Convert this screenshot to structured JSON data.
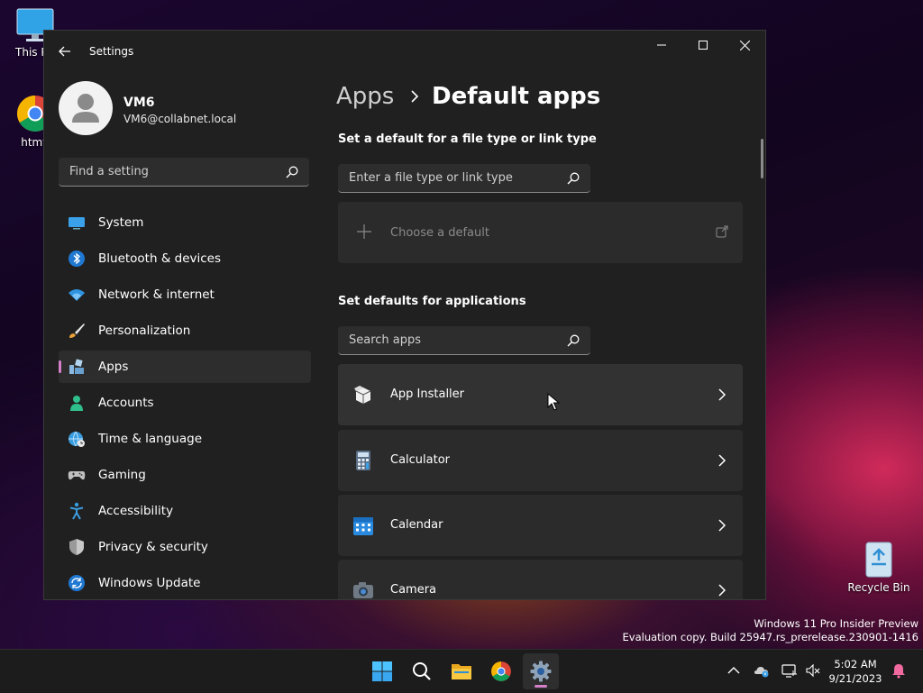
{
  "desktop": {
    "icons": [
      {
        "label": "This PC",
        "name": "desktop-icon-this-pc"
      },
      {
        "label": "htmfi",
        "name": "desktop-icon-chrome-shortcut"
      },
      {
        "label": "Recycle Bin",
        "name": "desktop-icon-recycle-bin"
      }
    ],
    "watermark": {
      "line1": "Windows 11 Pro Insider Preview",
      "line2": "Evaluation copy. Build 25947.rs_prerelease.230901-1416"
    }
  },
  "window": {
    "title": "Settings",
    "profile": {
      "name": "VM6",
      "email": "VM6@collabnet.local"
    },
    "search": {
      "placeholder": "Find a setting"
    },
    "nav": [
      {
        "label": "System",
        "icon": "monitor-icon",
        "active": false
      },
      {
        "label": "Bluetooth & devices",
        "icon": "bluetooth-icon",
        "active": false
      },
      {
        "label": "Network & internet",
        "icon": "wifi-icon",
        "active": false
      },
      {
        "label": "Personalization",
        "icon": "brush-icon",
        "active": false
      },
      {
        "label": "Apps",
        "icon": "apps-icon",
        "active": true
      },
      {
        "label": "Accounts",
        "icon": "person-icon",
        "active": false
      },
      {
        "label": "Time & language",
        "icon": "globe-clock-icon",
        "active": false
      },
      {
        "label": "Gaming",
        "icon": "gamepad-icon",
        "active": false
      },
      {
        "label": "Accessibility",
        "icon": "accessibility-icon",
        "active": false
      },
      {
        "label": "Privacy & security",
        "icon": "shield-icon",
        "active": false
      },
      {
        "label": "Windows Update",
        "icon": "update-icon",
        "active": false
      }
    ],
    "breadcrumb": {
      "parent": "Apps",
      "current": "Default apps"
    },
    "filetype": {
      "heading": "Set a default for a file type or link type",
      "placeholder": "Enter a file type or link type",
      "choose_label": "Choose a default"
    },
    "apps_section": {
      "heading": "Set defaults for applications",
      "placeholder": "Search apps",
      "apps": [
        {
          "name": "App Installer",
          "icon": "box-icon"
        },
        {
          "name": "Calculator",
          "icon": "calculator-icon"
        },
        {
          "name": "Calendar",
          "icon": "calendar-icon"
        },
        {
          "name": "Camera",
          "icon": "camera-icon"
        }
      ]
    }
  },
  "taskbar": {
    "clock": {
      "time": "5:02 AM",
      "date": "9/21/2023"
    }
  },
  "colors": {
    "accent": "#d47fc8",
    "window_bg": "#202020",
    "card_bg": "#2b2b2b"
  }
}
